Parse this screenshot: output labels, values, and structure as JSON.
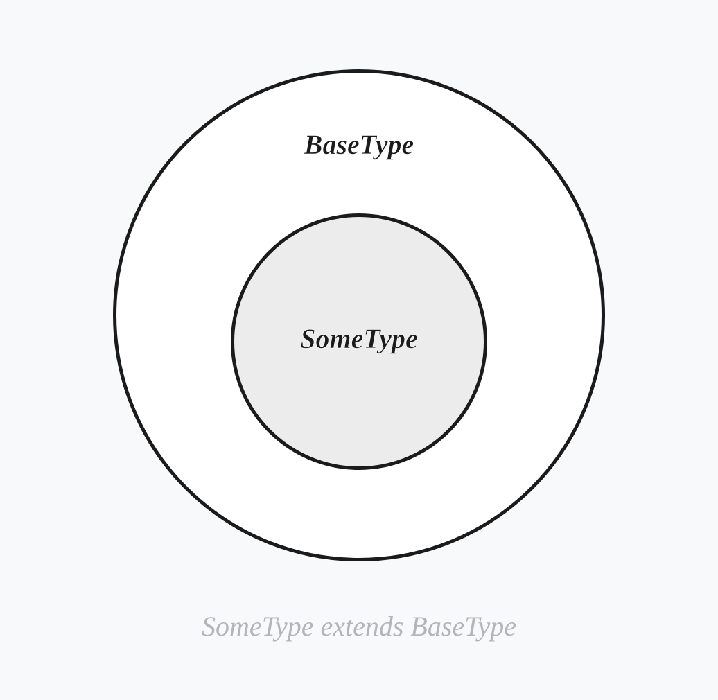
{
  "diagram": {
    "outer_label": "BaseType",
    "inner_label": "SomeType",
    "caption": "SomeType extends BaseType"
  },
  "colors": {
    "background": "#f8f9fa",
    "outer_fill": "#ffffff",
    "inner_fill": "#ececec",
    "stroke": "#1b1b1b",
    "caption": "#b2b6bb"
  },
  "chart_data": {
    "type": "venn",
    "sets": [
      {
        "name": "BaseType",
        "superset": true
      },
      {
        "name": "SomeType",
        "subset_of": "BaseType"
      }
    ],
    "relationship": "SomeType extends BaseType",
    "description": "Subset diagram showing SomeType is contained within BaseType"
  }
}
